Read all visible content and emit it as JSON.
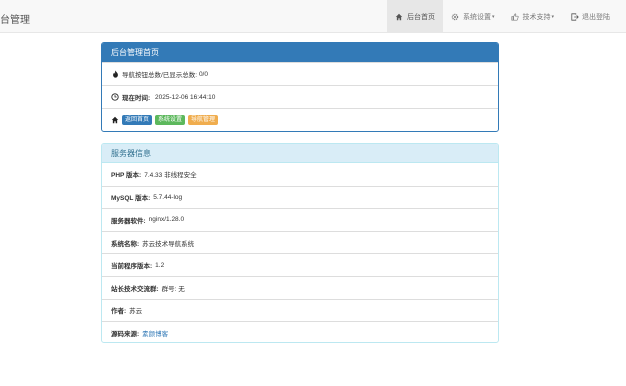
{
  "navbar": {
    "brand": "台管理",
    "items": [
      {
        "label": "后台首页",
        "icon": "home-icon",
        "active": true
      },
      {
        "label": "系统设置",
        "icon": "gear-icon",
        "caret": "▾"
      },
      {
        "label": "技术支持",
        "icon": "thumbs-up-icon",
        "caret": "▾"
      },
      {
        "label": "退出登陆",
        "icon": "logout-icon"
      }
    ]
  },
  "home_panel": {
    "title": "后台管理首页",
    "nav_count_label": "导航按钮总数/已显示总数:",
    "nav_count_value": "0/0",
    "time_label": "现在时间:",
    "time_value": "2025-12-06 16:44:10",
    "buttons": [
      "返回首页",
      "系统设置",
      "导航管理"
    ]
  },
  "server_panel": {
    "title": "服务器信息",
    "rows": [
      {
        "label": "PHP 版本:",
        "value": "7.4.33 非线程安全"
      },
      {
        "label": "MySQL 版本:",
        "value": "5.7.44-log"
      },
      {
        "label": "服务器软件:",
        "value": "nginx/1.28.0"
      },
      {
        "label": "系统名称:",
        "value": "苏云技术导航系统"
      },
      {
        "label": "当前程序版本:",
        "value": "1.2"
      },
      {
        "label": "站长技术交流群:",
        "value": "群号: 无"
      },
      {
        "label": "作者:",
        "value": "苏云"
      },
      {
        "label": "源码来源:",
        "value": "素颜博客"
      }
    ]
  },
  "colors": {
    "primary": "#337ab7",
    "info_bg": "#d9edf7",
    "success": "#5cb85c",
    "warning": "#f0ad4e"
  }
}
